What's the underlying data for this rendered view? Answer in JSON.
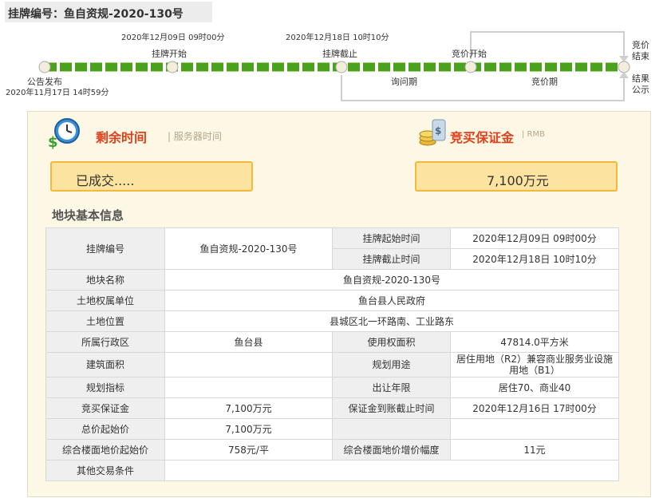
{
  "header": {
    "title": "挂牌编号：鱼自资规-2020-130号"
  },
  "timeline": {
    "announce": {
      "label": "公告发布",
      "time": "2020年11月17日 14时59分"
    },
    "listing_start": {
      "label": "挂牌开始",
      "time": "2020年12月09日 09时00分"
    },
    "listing_end": {
      "label": "挂牌截止",
      "time": "2020年12月18日 10时10分"
    },
    "bid_start": {
      "label": "竞价开始"
    },
    "bid_end": {
      "label": "竞价结束"
    },
    "result": {
      "label": "结果公示"
    },
    "inquiry_period": "询问期",
    "bid_period": "竞价期"
  },
  "status": {
    "remaining_label": "剩余时间",
    "server_time_label": "| 服务器时间",
    "status_value": "已成交.....",
    "deposit_label": "竞买保证金",
    "deposit_unit": "| RMB",
    "deposit_value": "7,100万元"
  },
  "section_title": "地块基本信息",
  "table": {
    "listing_no_label": "挂牌编号",
    "listing_no": "鱼自资规-2020-130号",
    "start_time_label": "挂牌起始时间",
    "start_time": "2020年12月09日 09时00分",
    "end_time_label": "挂牌截止时间",
    "end_time": "2020年12月18日 10时10分",
    "parcel_name_label": "地块名称",
    "parcel_name": "鱼自资规-2020-130号",
    "owner_label": "土地权属单位",
    "owner": "鱼台县人民政府",
    "location_label": "土地位置",
    "location": "县城区北一环路南、工业路东",
    "district_label": "所属行政区",
    "district": "鱼台县",
    "use_area_label": "使用权面积",
    "use_area": "47814.0平方米",
    "building_area_label": "建筑面积",
    "building_area": "",
    "planned_use_label": "规划用途",
    "planned_use": "居住用地（R2）兼容商业服务业设施用地（B1）",
    "planning_index_label": "规划指标",
    "planning_index": "",
    "lease_years_label": "出让年限",
    "lease_years": "居住70、商业40",
    "deposit_label": "竞买保证金",
    "deposit": "7,100万元",
    "deposit_deadline_label": "保证金到账截止时间",
    "deposit_deadline": "2020年12月16日 17时00分",
    "start_price_label": "总价起始价",
    "start_price": "7,100万元",
    "floor_price_label": "综合楼面地价起始价",
    "floor_price": "758元/平",
    "increment_label": "综合楼面地价增价幅度",
    "increment": "11元",
    "other_label": "其他交易条件",
    "other": ""
  }
}
